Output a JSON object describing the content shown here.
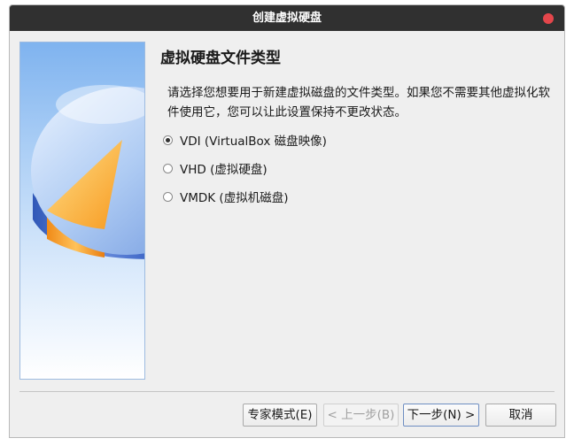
{
  "window": {
    "title": "创建虚拟硬盘"
  },
  "page": {
    "heading": "虚拟硬盘文件类型",
    "description": "请选择您想要用于新建虚拟磁盘的文件类型。如果您不需要其他虚拟化软件使用它，您可以让此设置保持不更改状态。"
  },
  "options": [
    {
      "label": "VDI (VirtualBox 磁盘映像)",
      "checked": true
    },
    {
      "label": "VHD (虚拟硬盘)",
      "checked": false
    },
    {
      "label": "VMDK (虚拟机磁盘)",
      "checked": false
    }
  ],
  "buttons": {
    "expert": "专家模式(E)",
    "back": "< 上一步(B)",
    "next": "下一步(N) >",
    "cancel": "取消"
  },
  "colors": {
    "titlebar": "#303030",
    "close": "#e4464b",
    "disk_orange": "#f7a635",
    "disk_blue": "#4a78d6"
  }
}
